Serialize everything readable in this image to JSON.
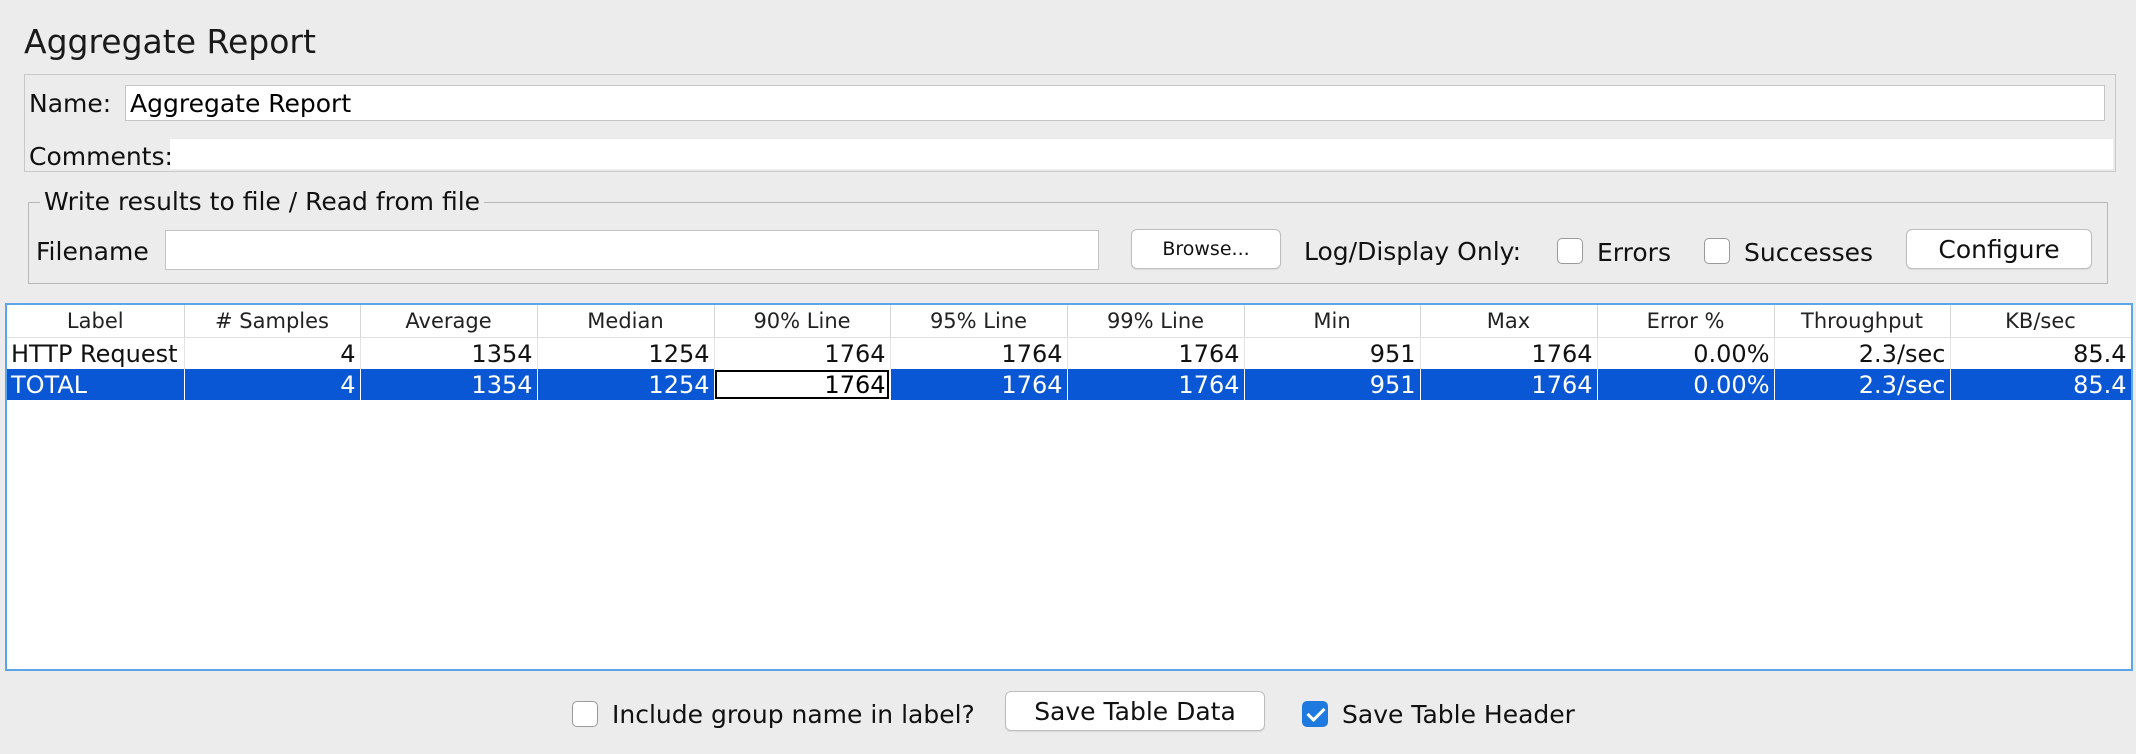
{
  "panel": {
    "title": "Aggregate Report"
  },
  "name_field": {
    "label": "Name:",
    "value": "Aggregate Report"
  },
  "comments_field": {
    "label": "Comments:",
    "value": ""
  },
  "file_section": {
    "legend": "Write results to file / Read from file",
    "filename_label": "Filename",
    "filename_value": "",
    "browse_label": "Browse...",
    "log_display_label": "Log/Display Only:",
    "errors_label": "Errors",
    "errors_checked": false,
    "successes_label": "Successes",
    "successes_checked": false,
    "configure_label": "Configure"
  },
  "table": {
    "columns": [
      "Label",
      "# Samples",
      "Average",
      "Median",
      "90% Line",
      "95% Line",
      "99% Line",
      "Min",
      "Max",
      "Error %",
      "Throughput",
      "KB/sec"
    ],
    "rows": [
      [
        "HTTP Request",
        "4",
        "1354",
        "1254",
        "1764",
        "1764",
        "1764",
        "951",
        "1764",
        "0.00%",
        "2.3/sec",
        "85.4"
      ],
      [
        "TOTAL",
        "4",
        "1354",
        "1254",
        "1764",
        "1764",
        "1764",
        "951",
        "1764",
        "0.00%",
        "2.3/sec",
        "85.4"
      ]
    ]
  },
  "footer": {
    "include_group_label": "Include group name in label?",
    "include_group_checked": false,
    "save_table_data_label": "Save Table Data",
    "save_table_header_label": "Save Table Header",
    "save_table_header_checked": true
  },
  "colors": {
    "selection": "#0a57d6",
    "checkbox_checked": "#1f7ae0",
    "focus_border": "#5aa6e8"
  }
}
